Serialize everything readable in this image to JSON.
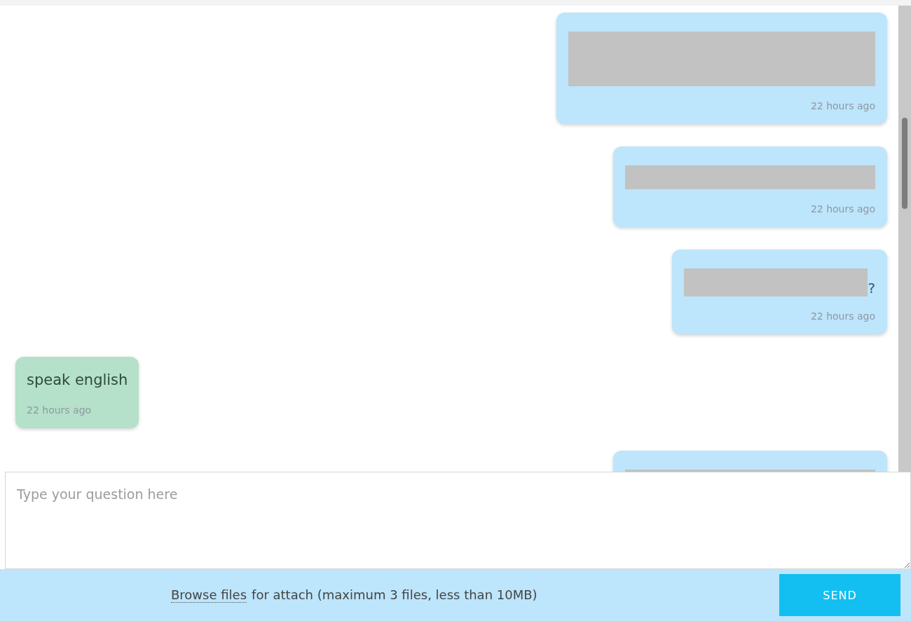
{
  "messages": [
    {
      "kind": "outgoing",
      "redaction": {
        "kind": "tall"
      },
      "time": "22 hours ago"
    },
    {
      "kind": "outgoing",
      "redaction": {
        "kind": "wide"
      },
      "time": "22 hours ago"
    },
    {
      "kind": "outgoing",
      "redaction": {
        "kind": "short"
      },
      "text": "?",
      "time": "22 hours ago"
    },
    {
      "kind": "incoming",
      "text": "speak english",
      "time": "22 hours ago"
    },
    {
      "kind": "outgoing",
      "redaction": {
        "kind": "wide"
      }
    }
  ],
  "composer": {
    "placeholder": "Type your question here"
  },
  "attach": {
    "link": "Browse files",
    "note": "for attach (maximum 3 files, less than 10MB)"
  },
  "send_button": "SEND"
}
